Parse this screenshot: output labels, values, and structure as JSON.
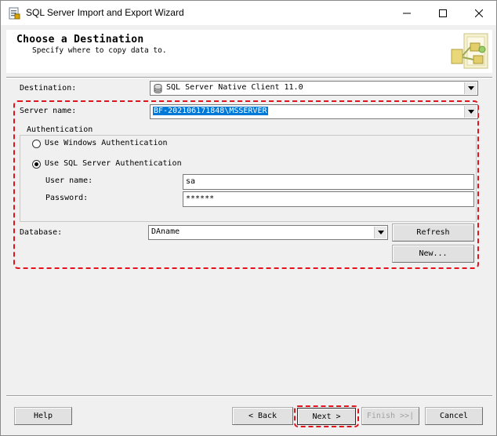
{
  "window": {
    "title": "SQL Server Import and Export Wizard",
    "controls": {
      "minimize_icon": "minimize-icon",
      "maximize_icon": "maximize-icon",
      "close_icon": "close-icon"
    }
  },
  "header": {
    "title": "Choose a Destination",
    "subtitle": "Specify where to copy data to."
  },
  "form": {
    "destination_label": "Destination:",
    "destination_value": "SQL Server Native Client 11.0",
    "server_name_label": "Server name:",
    "server_name_value": "BF-202106171848\\MSSERVER",
    "authentication_title": "Authentication",
    "windows_auth_label": "Use Windows Authentication",
    "sql_auth_label": "Use SQL Server Authentication",
    "selected_auth": "sql",
    "username_label": "User name:",
    "username_value": "sa",
    "password_label": "Password:",
    "password_value": "******",
    "database_label": "Database:",
    "database_value": "DAname",
    "refresh_label": "Refresh",
    "new_label": "New..."
  },
  "footer": {
    "help_label": "Help",
    "back_label": "< Back",
    "next_label": "Next >",
    "finish_label": "Finish >>|",
    "cancel_label": "Cancel"
  },
  "colors": {
    "highlight_frame": "#e0141c",
    "selection": "#0078d7",
    "dialog_bg": "#f0f0f0"
  }
}
